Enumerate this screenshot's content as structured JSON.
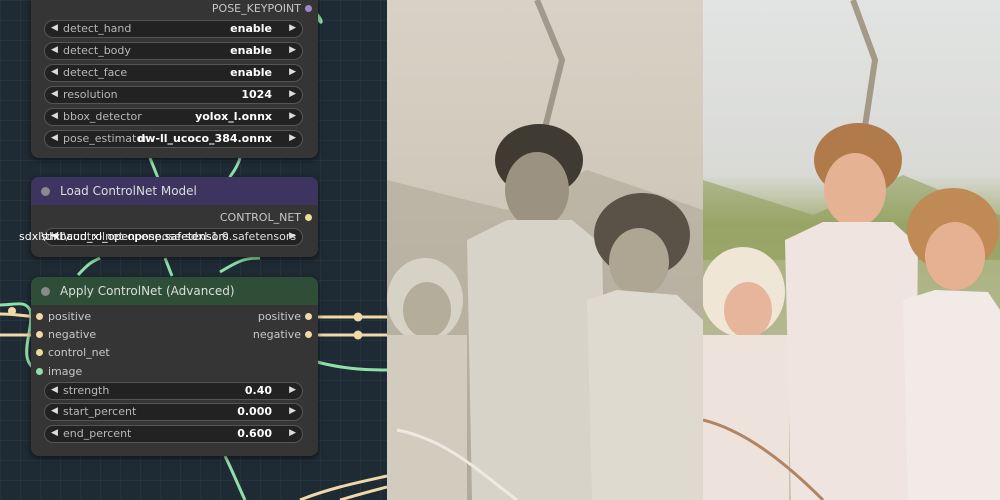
{
  "pose_node": {
    "output_label": "POSE_KEYPOINT",
    "widgets": [
      {
        "name": "detect_hand",
        "value": "enable"
      },
      {
        "name": "detect_body",
        "value": "enable"
      },
      {
        "name": "detect_face",
        "value": "enable"
      },
      {
        "name": "resolution",
        "value": "1024"
      },
      {
        "name": "bbox_detector",
        "value": "yolox_l.onnx"
      },
      {
        "name": "pose_estimator",
        "value": "dw-ll_ucoco_384.onnx"
      }
    ]
  },
  "load_controlnet": {
    "title": "Load ControlNet Model",
    "output_label": "CONTROL_NET",
    "model_name": "sdxl\\thibaud_xl_openpose.safetensors",
    "model_name_overlay": "sdxl\\controlnet-openpose-sdxl-1.0.safetensors"
  },
  "apply_controlnet": {
    "title": "Apply ControlNet (Advanced)",
    "inputs": [
      "positive",
      "negative",
      "control_net",
      "image"
    ],
    "outputs": [
      "positive",
      "negative"
    ],
    "widgets": [
      {
        "name": "strength",
        "value": "0.40"
      },
      {
        "name": "start_percent",
        "value": "0.000"
      },
      {
        "name": "end_percent",
        "value": "0.600"
      }
    ]
  },
  "colors": {
    "canvas_bg": "#1e2a34",
    "node_body": "#353535",
    "purple_title": "#3d3560",
    "green_title": "#2f4e38",
    "wire_green": "#8ee0a6",
    "wire_cond": "#f1d8a8"
  },
  "icons": {
    "arrow_left": "◀",
    "arrow_right": "▶"
  }
}
